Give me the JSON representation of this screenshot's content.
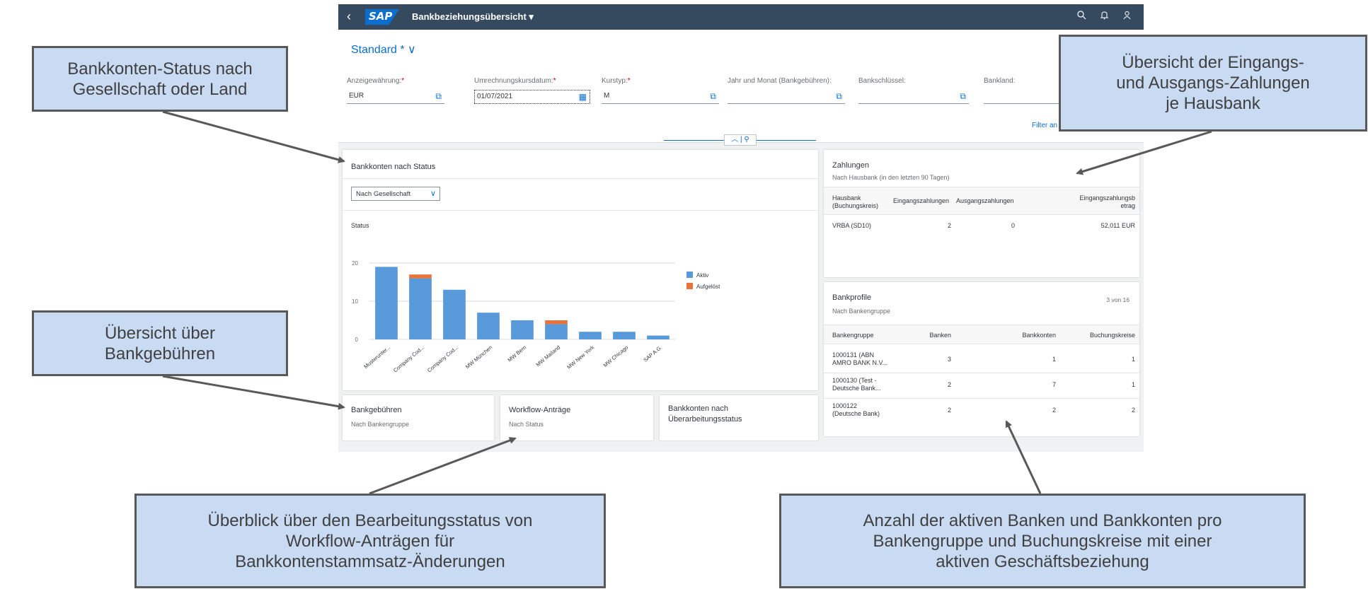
{
  "shell": {
    "title": "Bankbeziehungsübersicht ▾",
    "logo_text": "SAP",
    "back_glyph": "‹",
    "icons": [
      "search-icon",
      "bell-icon",
      "user-icon"
    ]
  },
  "filterbar": {
    "variant": "Standard * ∨",
    "fields": [
      {
        "label": "Anzeigewährung:",
        "required": true,
        "value": "EUR"
      },
      {
        "label": "Umrechnungskursdatum:",
        "required": true,
        "value": "01/07/2021"
      },
      {
        "label": "Kurstyp:",
        "required": true,
        "value": "M"
      },
      {
        "label": "Jahr und Monat (Bankgebühren):",
        "required": false,
        "value": ""
      },
      {
        "label": "Bankschlüssel:",
        "required": false,
        "value": ""
      },
      {
        "label": "Bankland:",
        "required": false,
        "value": ""
      }
    ],
    "filter_link": "Filter an",
    "required_mark": "*"
  },
  "status_card": {
    "title": "Bankkonten nach Status",
    "select_value": "Nach Gesellschaft",
    "chart_label": "Status"
  },
  "chart_data": {
    "type": "bar",
    "stacked": true,
    "categories": [
      "Musterunter...",
      "Company Cod...",
      "Company Cod...",
      "MW München",
      "MW Bern",
      "MW Mailand",
      "MW New York",
      "MW Chicago",
      "SAP A.G."
    ],
    "series": [
      {
        "name": "Aktiv",
        "color": "#5899da",
        "values": [
          19,
          16,
          13,
          7,
          5,
          4,
          2,
          2,
          1
        ]
      },
      {
        "name": "Aufgelöst",
        "color": "#e8743b",
        "values": [
          0,
          1,
          0,
          0,
          0,
          1,
          0,
          0,
          0
        ]
      }
    ],
    "yticks": [
      0,
      10,
      20
    ],
    "ylim": [
      0,
      20
    ],
    "legend_position": "right",
    "grid": true
  },
  "payments": {
    "title": "Zahlungen",
    "subtitle": "Nach Hausbank (in den letzten 90 Tagen)",
    "columns": [
      "Hausbank (Buchungskreis)",
      "Eingangszahlungen",
      "Ausgangszahlungen",
      "Eingangszahlungsbetrag"
    ],
    "col_display": [
      "Hausbank\n(Buchungskreis)",
      "Eingangszahlungen",
      "Ausgangszahlungen",
      "Eingangszahlungsb\netrag"
    ],
    "rows": [
      [
        "VRBA (SD10)",
        "2",
        "0",
        "52,011 EUR"
      ]
    ]
  },
  "profiles": {
    "title": "Bankprofile",
    "subtitle": "Nach Bankengruppe",
    "count": "3 von 16",
    "columns": [
      "Bankengruppe",
      "Banken",
      "Bankkonten",
      "Buchungskreise"
    ],
    "rows": [
      [
        "1000131 (ABN\nAMRO BANK N.V...",
        "3",
        "1",
        "1"
      ],
      [
        "1000130 (Test -\nDeutsche Bank...",
        "2",
        "7",
        "1"
      ],
      [
        "1000122\n(Deutsche Bank)",
        "2",
        "2",
        "2"
      ]
    ]
  },
  "tiles": [
    {
      "title": "Bankgebühren",
      "subtitle": "Nach Bankengruppe"
    },
    {
      "title": "Workflow-Anträge",
      "subtitle": "Nach Status"
    },
    {
      "title": "Bankkonten nach\nÜberarbeitungsstatus",
      "subtitle": ""
    }
  ],
  "callouts": {
    "status": "Bankkonten-Status nach\nGesellschaft oder Land",
    "payments": "Übersicht der Eingangs-\nund Ausgangs-Zahlungen\nje Hausbank",
    "fees": "Übersicht über\nBankgebühren",
    "workflow": "Überblick über den Bearbeitungsstatus von\nWorkflow-Anträgen für\nBankkontenstammsatz-Änderungen",
    "profiles": "Anzahl der aktiven Banken und Bankkonten pro\nBankengruppe und Buchungskreise mit einer\naktiven Geschäftsbeziehung"
  },
  "colors": {
    "shell": "#354a5f",
    "accent": "#0a6ed1",
    "callout_fill": "#c9daf3",
    "callout_border": "#595959"
  }
}
